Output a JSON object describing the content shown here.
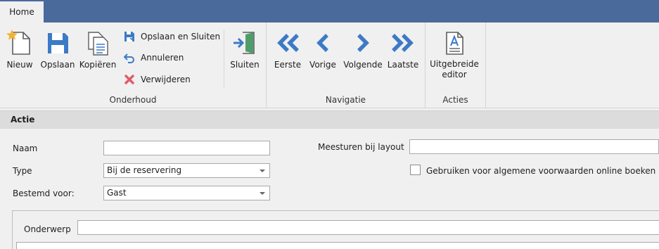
{
  "tabs": {
    "home": "Home"
  },
  "ribbon": {
    "onderhoud": {
      "nieuw": "Nieuw",
      "opslaan": "Opslaan",
      "kopieren": "Kopiëren",
      "opslaan_sluiten": "Opslaan en Sluiten",
      "annuleren": "Annuleren",
      "verwijderen": "Verwijderen",
      "group_label": "Onderhoud"
    },
    "sluiten": "Sluiten",
    "navigatie": {
      "eerste": "Eerste",
      "vorige": "Vorige",
      "volgende": "Volgende",
      "laatste": "Laatste",
      "group_label": "Navigatie"
    },
    "acties": {
      "editor_line1": "Uitgebreide",
      "editor_line2": "editor",
      "group_label": "Acties"
    }
  },
  "section": {
    "title": "Actie"
  },
  "form": {
    "naam_label": "Naam",
    "naam_value": "",
    "type_label": "Type",
    "type_value": "Bij de reservering",
    "bestemd_label": "Bestemd voor:",
    "bestemd_value": "Gast",
    "meesturen_label": "Meesturen bij layout",
    "meesturen_value": "",
    "algemene_label": "Gebruiken voor algemene voorwaarden online boeken",
    "onderwerp_label": "Onderwerp",
    "onderwerp_value": ""
  },
  "colors": {
    "accent": "#4a6a9c",
    "icon_blue": "#3d7ac6",
    "delete_red": "#e05a6a",
    "star": "#f2b233"
  },
  "icons": [
    "new-doc-star-icon",
    "save-disk-icon",
    "copy-icon",
    "save-close-icon",
    "undo-arrow-icon",
    "delete-x-icon",
    "exit-door-icon",
    "double-left-icon",
    "left-icon",
    "right-icon",
    "double-right-icon",
    "editor-doc-icon"
  ]
}
